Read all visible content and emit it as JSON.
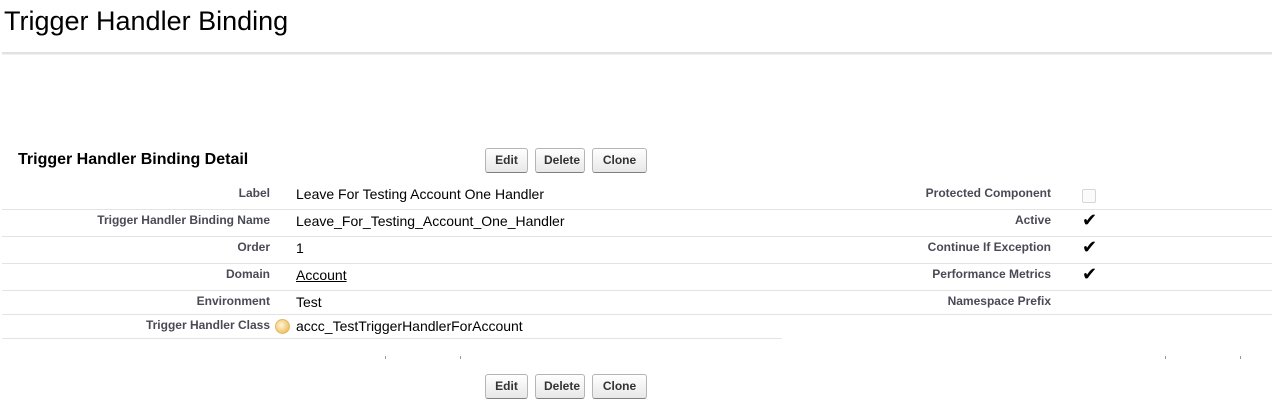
{
  "page": {
    "title": "Trigger Handler Binding"
  },
  "detail": {
    "section_title": "Trigger Handler Binding Detail",
    "buttons": {
      "edit": "Edit",
      "delete": "Delete",
      "clone": "Clone"
    },
    "left_fields": [
      {
        "label": "Label",
        "value": "Leave For Testing Account One Handler"
      },
      {
        "label": "Trigger Handler Binding Name",
        "value": "Leave_For_Testing_Account_One_Handler"
      },
      {
        "label": "Order",
        "value": "1"
      },
      {
        "label": "Domain",
        "value": "Account",
        "is_link": true
      },
      {
        "label": "Environment",
        "value": "Test"
      },
      {
        "label": "Trigger Handler Class",
        "value": "accc_TestTriggerHandlerForAccount",
        "has_help_icon": true
      }
    ],
    "right_fields": [
      {
        "label": "Protected Component",
        "checked": false
      },
      {
        "label": "Active",
        "checked": true
      },
      {
        "label": "Continue If Exception",
        "checked": true
      },
      {
        "label": "Performance Metrics",
        "checked": true
      },
      {
        "label": "Namespace Prefix",
        "value": ""
      }
    ],
    "checkmark_glyph": "✔"
  }
}
